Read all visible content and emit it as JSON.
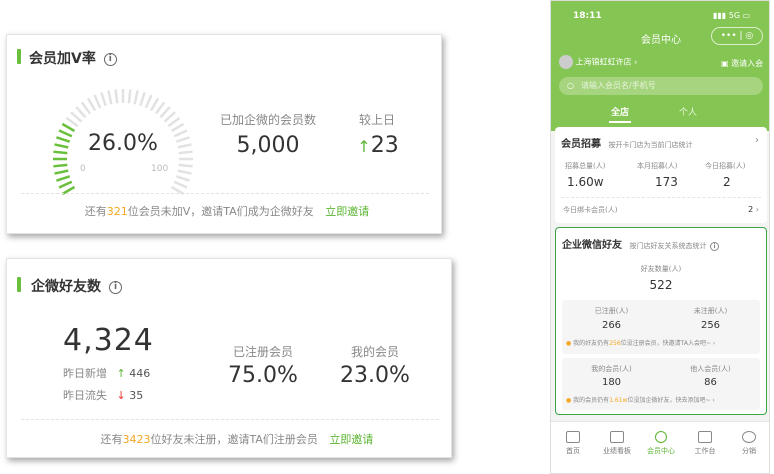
{
  "card1": {
    "title": "会员加V率",
    "info_icon": "i",
    "gauge_value": "26.0%",
    "gauge_min": "0",
    "gauge_max": "100",
    "gauge_fraction": 0.26,
    "joined_label": "已加企微的会员数",
    "joined_value": "5,000",
    "compare_label": "较上日",
    "compare_value": "23",
    "footer_pre": "还有",
    "footer_num": "321",
    "footer_post": "位会员未加V，邀请TA们成为企微好友",
    "footer_link": "立即邀请"
  },
  "card2": {
    "title": "企微好友数",
    "info_icon": "i",
    "total": "4,324",
    "new_label": "昨日新增",
    "new_value": "446",
    "lost_label": "昨日流失",
    "lost_value": "35",
    "registered_label": "已注册会员",
    "registered_value": "75.0%",
    "mine_label": "我的会员",
    "mine_value": "23.0%",
    "footer_pre": "还有",
    "footer_num": "3423",
    "footer_post": "位好友未注册，邀请TA们注册会员",
    "footer_link": "立即邀请"
  },
  "phone": {
    "time": "18:11",
    "signal": "5G",
    "title": "会员中心",
    "store": "上海锦虹虹许店",
    "invite": "邀请入会",
    "search_placeholder": "请输入会员名/手机号",
    "tabs": [
      "全店",
      "个人"
    ],
    "recruit": {
      "title": "会员招募",
      "sub": "按开卡门店为当前门店统计",
      "stats": [
        {
          "label": "招募总量(人)",
          "value": "1.60w"
        },
        {
          "label": "本月招募(人)",
          "value": "173"
        },
        {
          "label": "今日招募(人)",
          "value": "2"
        }
      ],
      "today_label": "今日绑卡会员(人)",
      "today_value": "2"
    },
    "wecom": {
      "title": "企业微信好友",
      "sub": "按门店好友关系统态统计",
      "friends_label": "好友数量(人)",
      "friends_value": "522",
      "reg_label": "已注册(人)",
      "reg_value": "266",
      "unreg_label": "未注册(人)",
      "unreg_value": "256",
      "tip1_pre": "我的好友仍有",
      "tip1_num": "256",
      "tip1_post": "位没注册会员，快邀请TA入会吧~",
      "mine_label": "我的会员(人)",
      "mine_value": "180",
      "other_label": "他人会员(人)",
      "other_value": "86",
      "tip2_pre": "我的会员仍有",
      "tip2_num": "1.61w",
      "tip2_post": "位没加企微好友，快去添加吧~"
    },
    "nav": [
      "首页",
      "业绩看板",
      "会员中心",
      "工作台",
      "分销"
    ]
  }
}
